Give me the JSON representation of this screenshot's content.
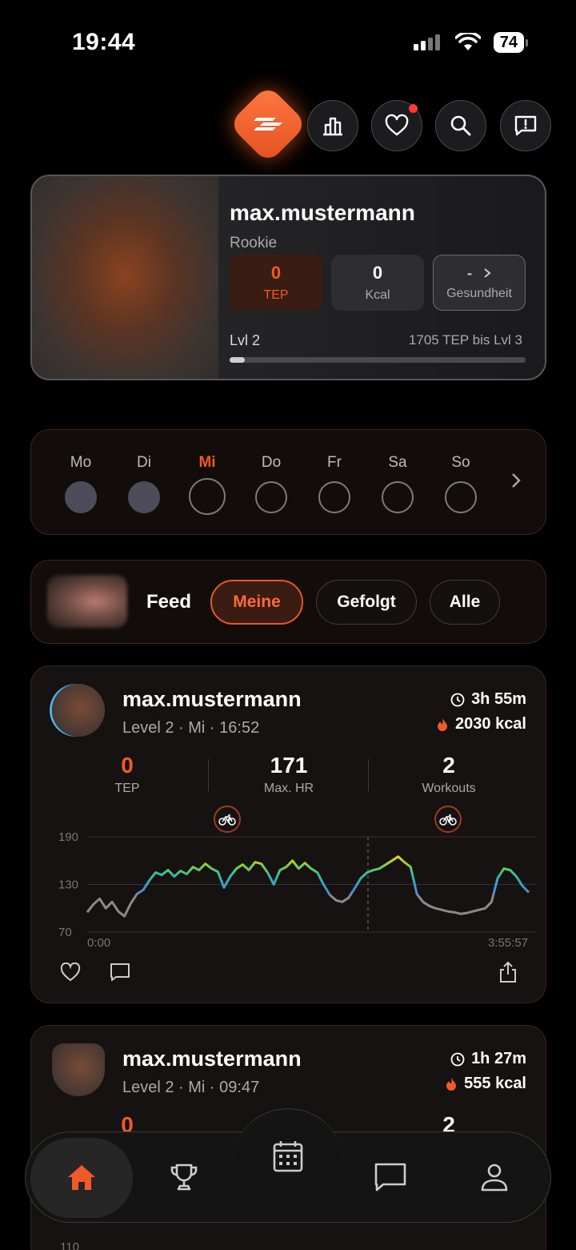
{
  "status": {
    "time": "19:44",
    "battery": "74"
  },
  "profile": {
    "username": "max.mustermann",
    "rank": "Rookie",
    "stats": [
      {
        "value": "0",
        "label": "TEP"
      },
      {
        "value": "0",
        "label": "Kcal"
      },
      {
        "value": "-",
        "label": "Gesundheit"
      }
    ],
    "level": "Lvl 2",
    "next_level": "1705 TEP bis Lvl 3",
    "progress": 0.05
  },
  "week": {
    "days": [
      {
        "label": "Mo",
        "state": "done"
      },
      {
        "label": "Di",
        "state": "done"
      },
      {
        "label": "Mi",
        "state": "today"
      },
      {
        "label": "Do",
        "state": "empty"
      },
      {
        "label": "Fr",
        "state": "empty"
      },
      {
        "label": "Sa",
        "state": "empty"
      },
      {
        "label": "So",
        "state": "empty"
      }
    ]
  },
  "feed": {
    "label": "Feed",
    "filters": [
      "Meine",
      "Gefolgt",
      "Alle"
    ],
    "active_filter": "Meine"
  },
  "activities": [
    {
      "username": "max.mustermann",
      "subtitle": "Level 2 · Mi · 16:52",
      "duration": "3h 55m",
      "kcal": "2030 kcal",
      "tep": {
        "value": "0",
        "label": "TEP"
      },
      "max_hr": {
        "value": "171",
        "label": "Max. HR"
      },
      "workouts": {
        "value": "2",
        "label": "Workouts"
      },
      "chart": {
        "y_ticks": [
          "190",
          "130",
          "70"
        ],
        "x_start": "0:00",
        "x_end": "3:55:57"
      }
    },
    {
      "username": "max.mustermann",
      "subtitle": "Level 2 · Mi · 09:47",
      "duration": "1h 27m",
      "kcal": "555 kcal",
      "tep": {
        "value": "0"
      },
      "workouts": {
        "value": "2"
      },
      "chart": {
        "y_tick": "110"
      }
    }
  ],
  "chart_data": {
    "type": "line",
    "title": "",
    "xlabel": "",
    "ylabel": "",
    "x_range": [
      "0:00",
      "3:55:57"
    ],
    "ylim": [
      70,
      190
    ],
    "series": [
      {
        "values": [
          95,
          105,
          112,
          100,
          108,
          96,
          90,
          106,
          118,
          123,
          135,
          145,
          142,
          148,
          140,
          147,
          143,
          152,
          148,
          156,
          150,
          146,
          126,
          140,
          150,
          155,
          148,
          158,
          156,
          145,
          130,
          148,
          152,
          160,
          150,
          157,
          150,
          145,
          130,
          117,
          110,
          108,
          113,
          125,
          138,
          145,
          148,
          150,
          155,
          160,
          165,
          158,
          152,
          118,
          108,
          103,
          100,
          98,
          96,
          95,
          93,
          94,
          96,
          98,
          100,
          108,
          138,
          150,
          148,
          140,
          128,
          120
        ]
      }
    ]
  }
}
